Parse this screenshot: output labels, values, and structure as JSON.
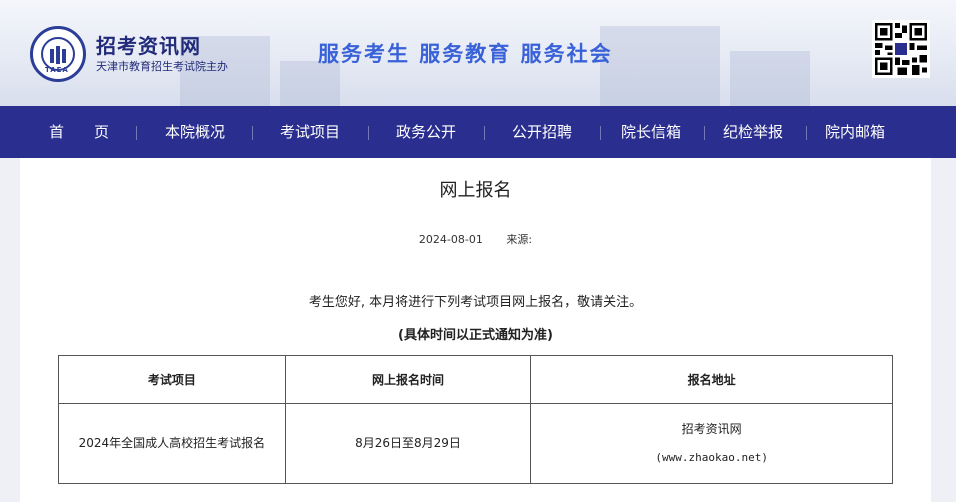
{
  "header": {
    "logo_text": "TAEA",
    "site_name": "招考资讯网",
    "site_sub": "天津市教育招生考试院主办",
    "slogan": "服务考生  服务教育  服务社会"
  },
  "nav": {
    "items": [
      "首　　页",
      "本院概况",
      "考试项目",
      "政务公开",
      "公开招聘",
      "院长信箱",
      "纪检举报",
      "院内邮箱"
    ]
  },
  "article": {
    "title": "网上报名",
    "date": "2024-08-01",
    "source_label": "来源:",
    "intro": "考生您好, 本月将进行下列考试项目网上报名，敬请关注。",
    "note": "(具体时间以正式通知为准)",
    "table": {
      "headers": [
        "考试项目",
        "网上报名时间",
        "报名地址"
      ],
      "rows": [
        {
          "project": "2024年全国成人高校招生考试报名",
          "time": "8月26日至8月29日",
          "site_name": "招考资讯网",
          "site_url": "(www.zhaokao.net)"
        }
      ]
    }
  },
  "colors": {
    "nav_bg": "#2a2e8e",
    "slogan": "#3a62d8",
    "brand": "#222b7a"
  }
}
